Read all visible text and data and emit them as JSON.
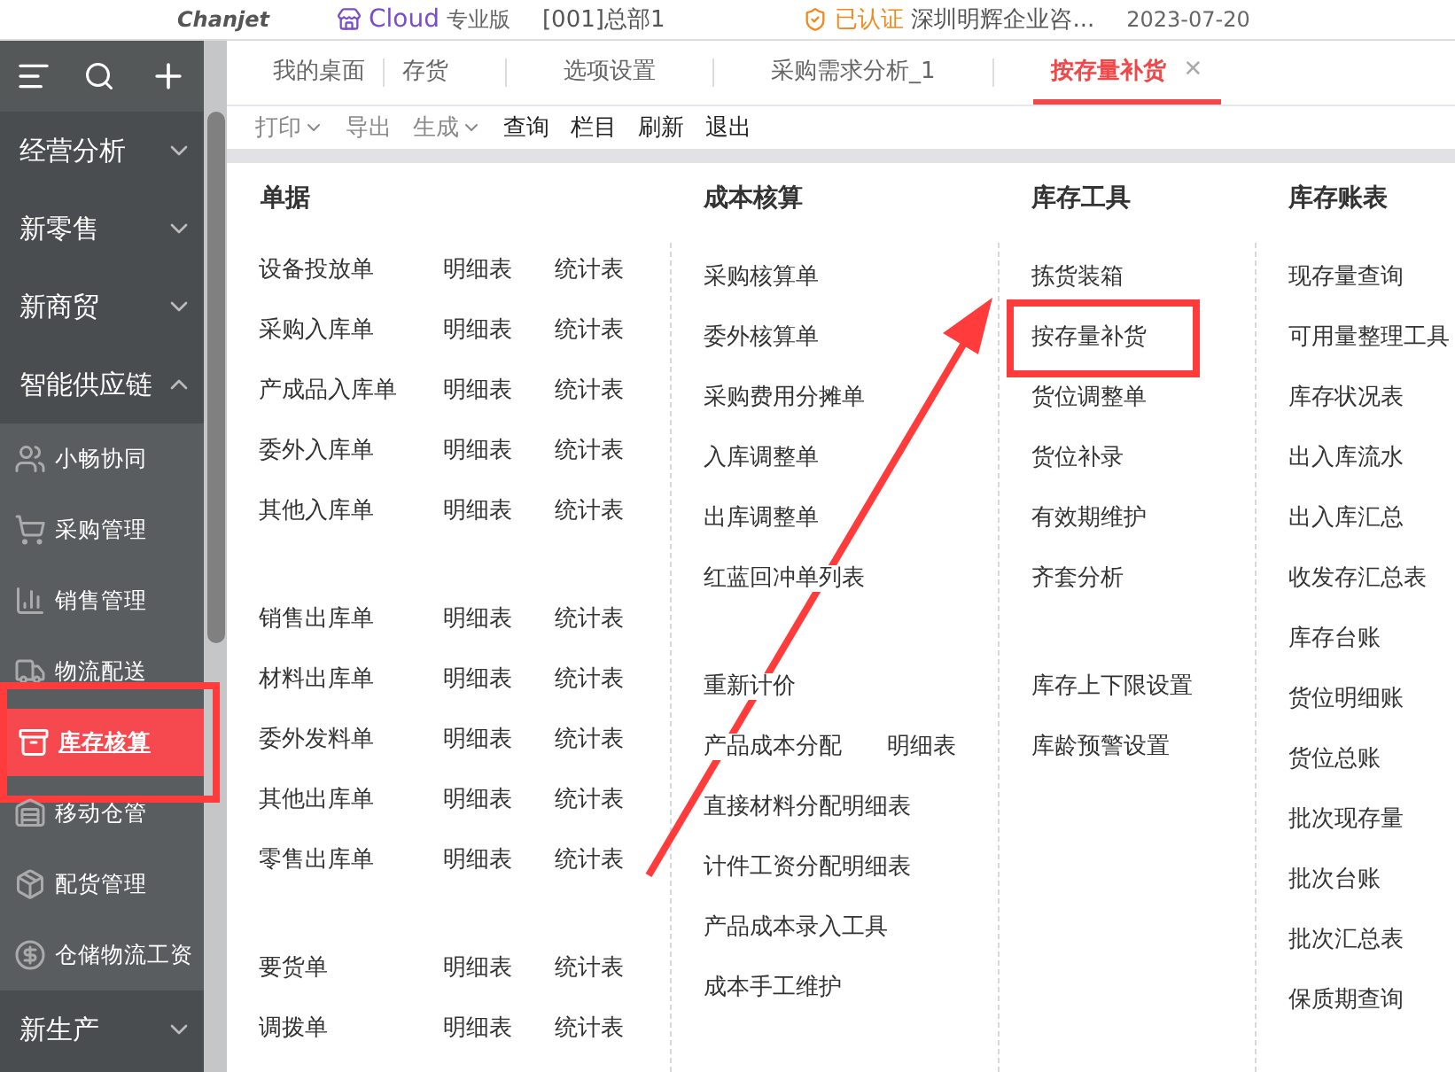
{
  "header": {
    "brand": "Chanjet",
    "product": "Cloud",
    "edition": "专业版",
    "org": "[001]总部1",
    "verified": "已认证",
    "company": "深圳明辉企业咨...",
    "date": "2023-07-20"
  },
  "sidebar": {
    "items": [
      {
        "kind": "group",
        "label": "经营分析",
        "expanded": false
      },
      {
        "kind": "group",
        "label": "新零售",
        "expanded": false
      },
      {
        "kind": "group",
        "label": "新商贸",
        "expanded": false
      },
      {
        "kind": "group",
        "label": "智能供应链",
        "expanded": true,
        "children": [
          {
            "label": "小畅协同",
            "selected": false,
            "highlighted": false
          },
          {
            "label": "采购管理",
            "selected": false,
            "highlighted": false
          },
          {
            "label": "销售管理",
            "selected": false,
            "highlighted": false
          },
          {
            "label": "物流配送",
            "selected": false,
            "highlighted": false
          },
          {
            "label": "库存核算",
            "selected": true,
            "highlighted": true
          },
          {
            "label": "移动仓管",
            "selected": false,
            "highlighted": false
          },
          {
            "label": "配货管理",
            "selected": false,
            "highlighted": false
          },
          {
            "label": "仓储物流工资",
            "selected": false,
            "highlighted": false
          }
        ]
      },
      {
        "kind": "group",
        "label": "新生产",
        "expanded": false
      }
    ]
  },
  "tabs": [
    {
      "label": "我的桌面",
      "selected": false,
      "closable": false
    },
    {
      "label": "存货",
      "selected": false,
      "closable": false
    },
    {
      "label": "选项设置",
      "selected": false,
      "closable": false
    },
    {
      "label": "采购需求分析_1",
      "selected": false,
      "closable": false
    },
    {
      "label": "按存量补货",
      "selected": true,
      "closable": true,
      "close": "✕"
    }
  ],
  "toolbar": [
    {
      "label": "打印",
      "disabled": true,
      "dropdown": true
    },
    {
      "label": "导出",
      "disabled": true,
      "dropdown": false
    },
    {
      "label": "生成",
      "disabled": true,
      "dropdown": true
    },
    {
      "label": "查询",
      "disabled": false,
      "dropdown": false
    },
    {
      "label": "栏目",
      "disabled": false,
      "dropdown": false
    },
    {
      "label": "刷新",
      "disabled": false,
      "dropdown": false
    },
    {
      "label": "退出",
      "disabled": false,
      "dropdown": false
    }
  ],
  "menu_columns": [
    {
      "title": "单据",
      "groups": [
        [
          {
            "label": "设备投放单",
            "links": [
              "明细表",
              "统计表"
            ]
          },
          {
            "label": "采购入库单",
            "links": [
              "明细表",
              "统计表"
            ]
          },
          {
            "label": "产成品入库单",
            "links": [
              "明细表",
              "统计表"
            ]
          },
          {
            "label": "委外入库单",
            "links": [
              "明细表",
              "统计表"
            ]
          },
          {
            "label": "其他入库单",
            "links": [
              "明细表",
              "统计表"
            ]
          }
        ],
        [
          {
            "label": "销售出库单",
            "links": [
              "明细表",
              "统计表"
            ]
          },
          {
            "label": "材料出库单",
            "links": [
              "明细表",
              "统计表"
            ]
          },
          {
            "label": "委外发料单",
            "links": [
              "明细表",
              "统计表"
            ]
          },
          {
            "label": "其他出库单",
            "links": [
              "明细表",
              "统计表"
            ]
          },
          {
            "label": "零售出库单",
            "links": [
              "明细表",
              "统计表"
            ]
          }
        ],
        [
          {
            "label": "要货单",
            "links": [
              "明细表",
              "统计表"
            ]
          },
          {
            "label": "调拨单",
            "links": [
              "明细表",
              "统计表"
            ]
          }
        ]
      ]
    },
    {
      "title": "成本核算",
      "groups": [
        [
          {
            "label": "采购核算单"
          },
          {
            "label": "委外核算单"
          },
          {
            "label": "采购费用分摊单"
          },
          {
            "label": "入库调整单"
          },
          {
            "label": "出库调整单"
          },
          {
            "label": "红蓝回冲单列表"
          }
        ],
        [
          {
            "label": "重新计价"
          },
          {
            "label": "产品成本分配",
            "links": [
              "明细表"
            ]
          },
          {
            "label": "直接材料分配明细表"
          },
          {
            "label": "计件工资分配明细表"
          },
          {
            "label": "产品成本录入工具"
          },
          {
            "label": "成本手工维护"
          }
        ]
      ]
    },
    {
      "title": "库存工具",
      "groups": [
        [
          {
            "label": "拣货装箱"
          },
          {
            "label": "按存量补货",
            "highlighted": true
          },
          {
            "label": "货位调整单"
          },
          {
            "label": "货位补录"
          },
          {
            "label": "有效期维护"
          },
          {
            "label": "齐套分析"
          }
        ],
        [
          {
            "label": "库存上下限设置"
          },
          {
            "label": "库龄预警设置"
          }
        ]
      ]
    },
    {
      "title": "库存账表",
      "groups": [
        [
          {
            "label": "现存量查询"
          },
          {
            "label": "可用量整理工具"
          },
          {
            "label": "库存状况表"
          },
          {
            "label": "出入库流水"
          },
          {
            "label": "出入库汇总"
          },
          {
            "label": "收发存汇总表"
          },
          {
            "label": "库存台账"
          },
          {
            "label": "货位明细账"
          },
          {
            "label": "货位总账"
          },
          {
            "label": "批次现存量"
          },
          {
            "label": "批次台账"
          },
          {
            "label": "批次汇总表"
          },
          {
            "label": "保质期查询"
          }
        ]
      ]
    }
  ]
}
